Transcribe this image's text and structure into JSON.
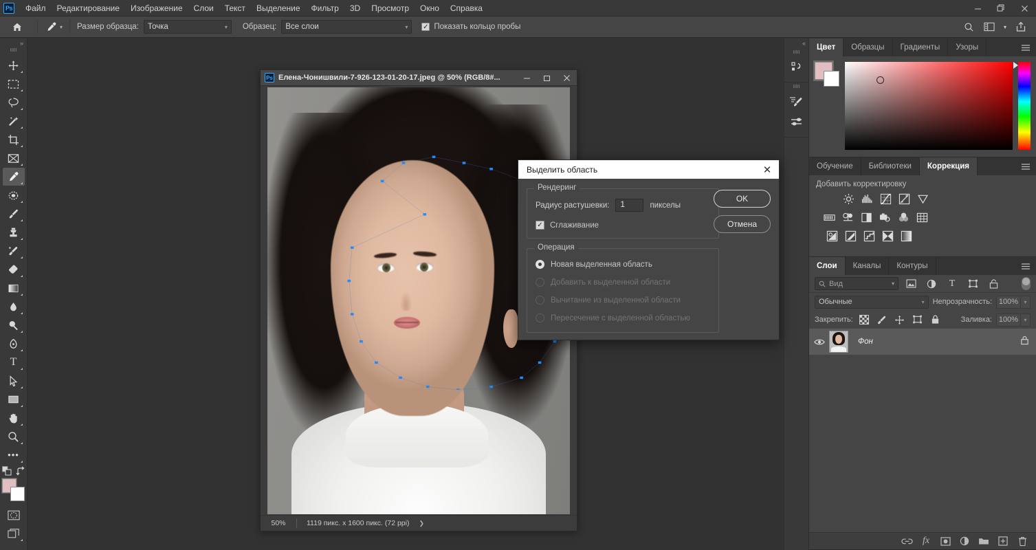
{
  "app": {
    "logo": "Ps",
    "menus": [
      "Файл",
      "Редактирование",
      "Изображение",
      "Слои",
      "Текст",
      "Выделение",
      "Фильтр",
      "3D",
      "Просмотр",
      "Окно",
      "Справка"
    ],
    "window_controls": {
      "minimize": "—",
      "restore": "❐",
      "close": "✕"
    }
  },
  "options_bar": {
    "home_icon": "home-icon",
    "tool_icon": "eyedropper-icon",
    "sample_size_label": "Размер образца:",
    "sample_size_value": "Точка",
    "sample_label": "Образец:",
    "sample_value": "Все слои",
    "show_ring_label": "Показать кольцо пробы",
    "show_ring_checked": true,
    "right_icons": [
      "search-icon",
      "workspace-icon",
      "chevron-down-icon",
      "share-icon"
    ]
  },
  "toolbar": {
    "collapse": "»",
    "tools": [
      {
        "name": "move-tool",
        "glyph": "✥"
      },
      {
        "name": "rectangular-marquee-tool",
        "glyph": "▭"
      },
      {
        "name": "lasso-tool",
        "glyph": "◯"
      },
      {
        "name": "magic-wand-tool",
        "glyph": "✦"
      },
      {
        "name": "crop-tool",
        "glyph": "⌗"
      },
      {
        "name": "frame-tool",
        "glyph": "⊠"
      },
      {
        "name": "eyedropper-tool",
        "glyph": "⌇",
        "active": true
      },
      {
        "name": "spot-healing-brush-tool",
        "glyph": "⬭"
      },
      {
        "name": "brush-tool",
        "glyph": "✎"
      },
      {
        "name": "clone-stamp-tool",
        "glyph": "⌶"
      },
      {
        "name": "history-brush-tool",
        "glyph": "⟐"
      },
      {
        "name": "eraser-tool",
        "glyph": "◧"
      },
      {
        "name": "gradient-tool",
        "glyph": "▤"
      },
      {
        "name": "blur-tool",
        "glyph": "💧"
      },
      {
        "name": "dodge-tool",
        "glyph": "🔍"
      },
      {
        "name": "pen-tool",
        "glyph": "✒"
      },
      {
        "name": "type-tool",
        "glyph": "T"
      },
      {
        "name": "path-selection-tool",
        "glyph": "➤"
      },
      {
        "name": "rectangle-tool",
        "glyph": "▬"
      },
      {
        "name": "hand-tool",
        "glyph": "✋"
      },
      {
        "name": "zoom-tool",
        "glyph": "🔎"
      },
      {
        "name": "edit-toolbar-button",
        "glyph": "•••"
      }
    ],
    "foreground_color": "#e0bec2",
    "background_color": "#ffffff",
    "quick_mask_icon": "quick-mask-icon",
    "screen_mode_icon": "screen-mode-icon"
  },
  "document": {
    "title": "Елена-Чонишвили-7-926-123-01-20-17.jpeg @ 50% (RGB/8#...",
    "logo": "Ps",
    "controls": {
      "minimize": "—",
      "maximize": "❐",
      "close": "✕"
    },
    "status_zoom": "50%",
    "status_dims": "1119 пикс. x 1600 пикс. (72 ppi)",
    "status_arrow": "❯"
  },
  "dialog": {
    "title": "Выделить область",
    "close": "✕",
    "rendering_legend": "Рендеринг",
    "feather_label": "Радиус растушевки:",
    "feather_value": "1",
    "feather_units": "пикселы",
    "antialias_label": "Сглаживание",
    "antialias_checked": true,
    "operation_legend": "Операция",
    "operations": [
      {
        "label": "Новая выделенная область",
        "selected": true,
        "enabled": true
      },
      {
        "label": "Добавить к выделенной области",
        "selected": false,
        "enabled": false
      },
      {
        "label": "Вычитание из выделенной области",
        "selected": false,
        "enabled": false
      },
      {
        "label": "Пересечение с выделенной областью",
        "selected": false,
        "enabled": false
      }
    ],
    "ok_label": "OK",
    "cancel_label": "Отмена"
  },
  "dock": {
    "collapse": "«",
    "expand": "»",
    "strip_icons": [
      "history-icon",
      "brush-settings-icon",
      "brush-presets-icon"
    ],
    "color_panel": {
      "tabs": [
        {
          "label": "Цвет",
          "active": true
        },
        {
          "label": "Образцы",
          "active": false
        },
        {
          "label": "Градиенты",
          "active": false
        },
        {
          "label": "Узоры",
          "active": false
        }
      ],
      "menu_icon": "panel-menu-icon",
      "foreground": "#e0bec2",
      "background": "#ffffff"
    },
    "adjustments_panel": {
      "tabs": [
        {
          "label": "Обучение",
          "active": false
        },
        {
          "label": "Библиотеки",
          "active": false
        },
        {
          "label": "Коррекция",
          "active": true
        }
      ],
      "menu_icon": "panel-menu-icon",
      "heading": "Добавить корректировку",
      "rows": [
        [
          "brightness-contrast-icon",
          "levels-icon",
          "curves-icon",
          "exposure-icon",
          "vibrance-icon"
        ],
        [
          "hue-saturation-icon",
          "color-balance-icon",
          "black-white-icon",
          "photo-filter-icon",
          "channel-mixer-icon",
          "color-lookup-icon"
        ],
        [
          "invert-icon",
          "posterize-icon",
          "threshold-icon",
          "selective-color-icon",
          "gradient-map-icon"
        ]
      ]
    },
    "layers_panel": {
      "tabs": [
        {
          "label": "Слои",
          "active": true
        },
        {
          "label": "Каналы",
          "active": false
        },
        {
          "label": "Контуры",
          "active": false
        }
      ],
      "menu_icon": "panel-menu-icon",
      "filter_placeholder": "Вид",
      "filter_icons": [
        "pixel-filter-icon",
        "adjustment-filter-icon",
        "type-filter-icon",
        "shape-filter-icon",
        "smart-object-filter-icon"
      ],
      "blend_mode": "Обычные",
      "opacity_label": "Непрозрачность:",
      "opacity_value": "100%",
      "lock_label": "Закрепить:",
      "lock_icons": [
        "lock-transparent-icon",
        "lock-image-icon",
        "lock-position-icon",
        "lock-artboard-icon",
        "lock-all-icon"
      ],
      "fill_label": "Заливка:",
      "fill_value": "100%",
      "layers": [
        {
          "name": "Фон",
          "visible": true,
          "locked": true
        }
      ],
      "bottom_icons": [
        "link-layers-icon",
        "layer-style-icon",
        "layer-mask-icon",
        "new-fill-adjustment-icon",
        "new-group-icon",
        "new-layer-icon",
        "delete-layer-icon"
      ]
    }
  },
  "selection_path": {
    "description": "face-selection-path",
    "stroke_color": "#3b7fd4",
    "anchor_color": "#1e8bff",
    "anchors": [
      [
        52,
        42
      ],
      [
        38,
        31
      ],
      [
        45,
        25
      ],
      [
        55,
        23
      ],
      [
        65,
        25
      ],
      [
        74,
        27
      ],
      [
        85,
        31
      ],
      [
        94,
        42
      ],
      [
        99,
        55
      ],
      [
        100,
        66
      ],
      [
        98,
        76
      ],
      [
        95,
        84
      ],
      [
        90,
        91
      ],
      [
        84,
        96
      ],
      [
        74,
        99
      ],
      [
        63,
        100
      ],
      [
        53,
        99
      ],
      [
        44,
        96
      ],
      [
        36,
        91
      ],
      [
        31,
        84
      ],
      [
        28,
        75
      ],
      [
        27,
        64
      ],
      [
        28,
        53
      ]
    ]
  }
}
